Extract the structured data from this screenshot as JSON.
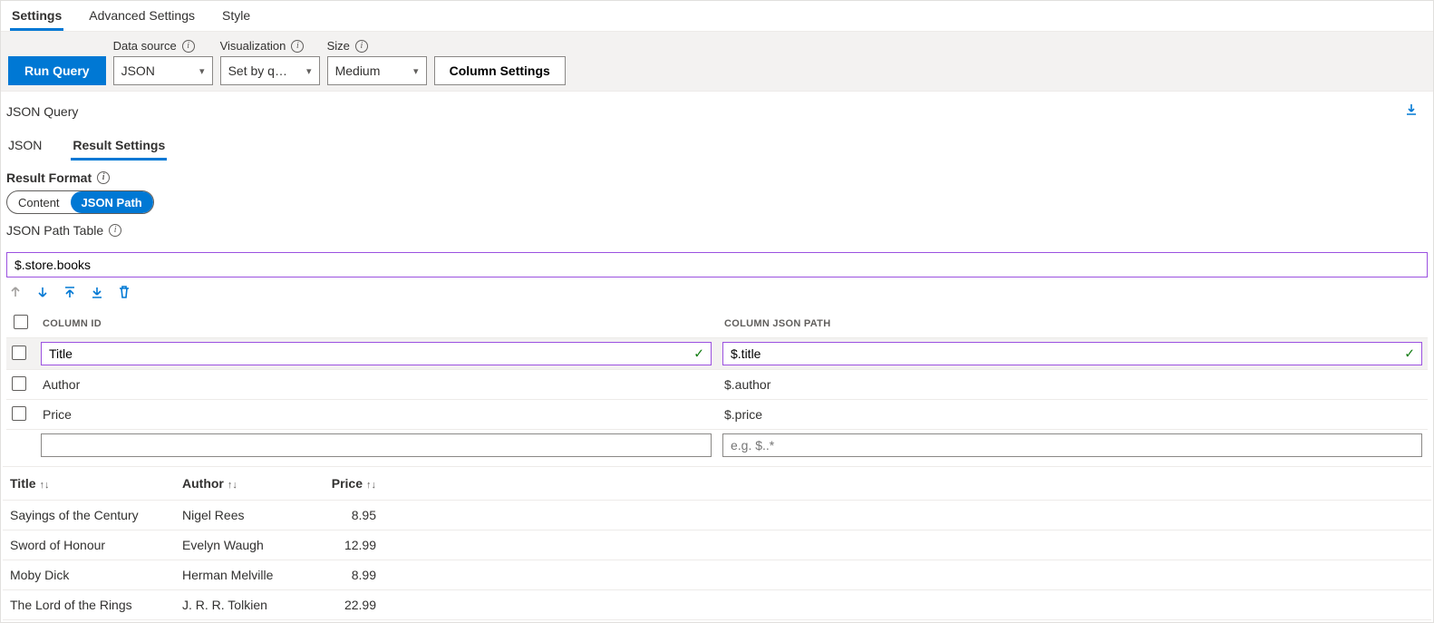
{
  "topTabs": {
    "t0": "Settings",
    "t1": "Advanced Settings",
    "t2": "Style"
  },
  "toolbar": {
    "run": "Run Query",
    "dataSourceLabel": "Data source",
    "dataSourceValue": "JSON",
    "vizLabel": "Visualization",
    "vizValue": "Set by query visualization",
    "sizeLabel": "Size",
    "sizeValue": "Medium",
    "columnSettings": "Column Settings"
  },
  "queryHeader": "JSON Query",
  "subTabs": {
    "t0": "JSON",
    "t1": "Result Settings"
  },
  "resultFormat": {
    "label": "Result Format",
    "opt0": "Content",
    "opt1": "JSON Path"
  },
  "jsonPathTable": {
    "label": "JSON Path Table",
    "value": "$.store.books"
  },
  "columnHeaders": {
    "id": "COLUMN ID",
    "path": "COLUMN JSON PATH"
  },
  "columns": {
    "r0": {
      "id": "Title",
      "path": "$.title"
    },
    "r1": {
      "id": "Author",
      "path": "$.author"
    },
    "r2": {
      "id": "Price",
      "path": "$.price"
    },
    "newPlaceholder": "e.g. $..*"
  },
  "results": {
    "h0": "Title",
    "h1": "Author",
    "h2": "Price",
    "r0": {
      "title": "Sayings of the Century",
      "author": "Nigel Rees",
      "price": "8.95"
    },
    "r1": {
      "title": "Sword of Honour",
      "author": "Evelyn Waugh",
      "price": "12.99"
    },
    "r2": {
      "title": "Moby Dick",
      "author": "Herman Melville",
      "price": "8.99"
    },
    "r3": {
      "title": "The Lord of the Rings",
      "author": "J. R. R. Tolkien",
      "price": "22.99"
    }
  }
}
